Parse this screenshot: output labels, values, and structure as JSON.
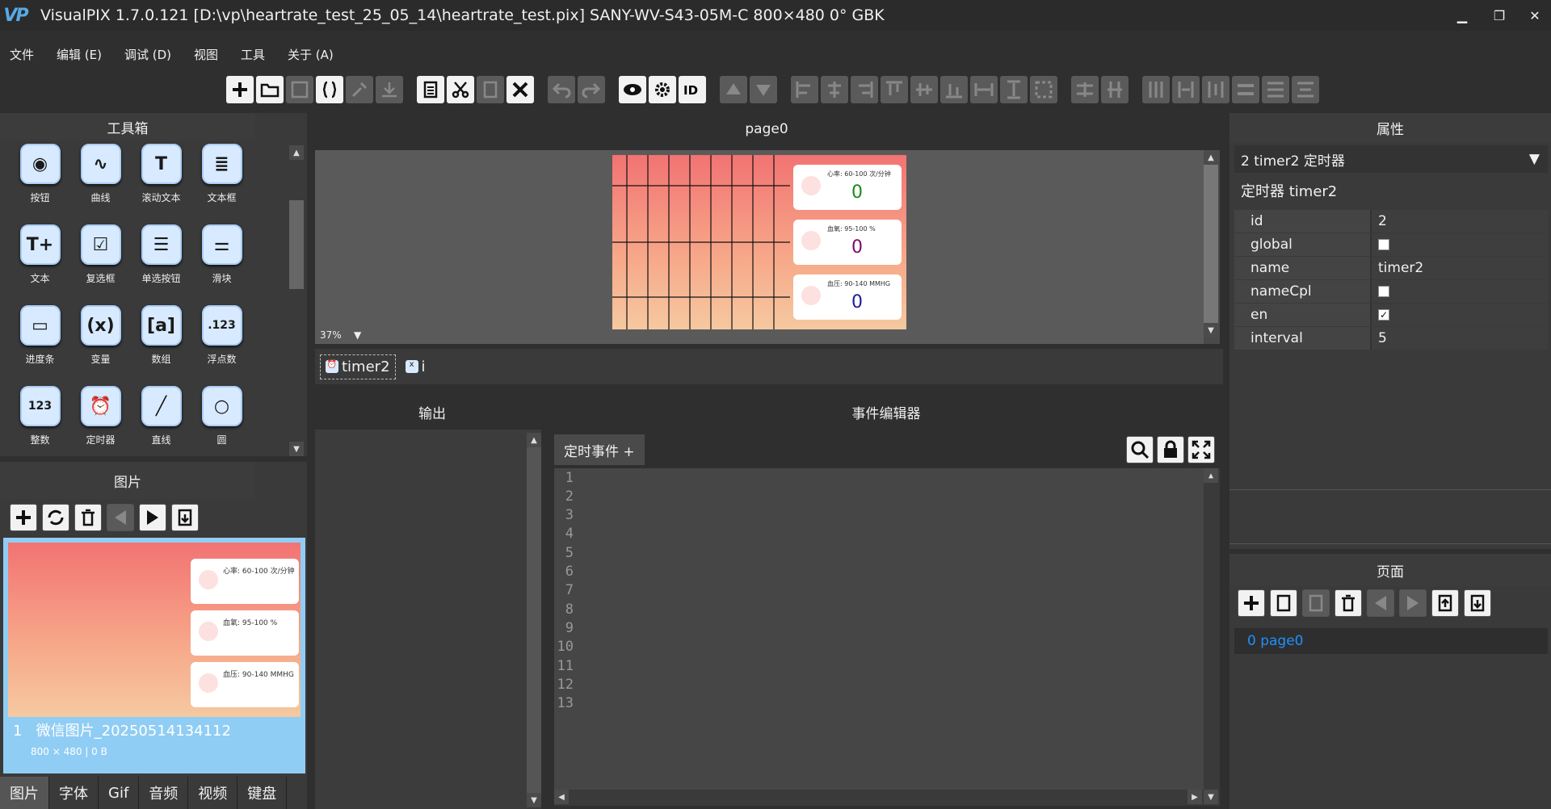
{
  "title_bar": {
    "logo": "VP",
    "text": "VisualPIX 1.7.0.121 [D:\\vp\\heartrate_test_25_05_14\\heartrate_test.pix]    SANY-WV-S43-05M-C    800×480    0°    GBK"
  },
  "menu": [
    "文件",
    "编辑 (E)",
    "调试 (D)",
    "视图",
    "工具",
    "关于 (A)"
  ],
  "toolbox": {
    "title": "工具箱",
    "items": [
      {
        "label": "按钮",
        "glyph": "◉"
      },
      {
        "label": "曲线",
        "glyph": "∿"
      },
      {
        "label": "滚动文本",
        "glyph": "T"
      },
      {
        "label": "文本框",
        "glyph": "≣"
      },
      {
        "label": "文本",
        "glyph": "T+"
      },
      {
        "label": "复选框",
        "glyph": "☑"
      },
      {
        "label": "单选按钮",
        "glyph": "☰"
      },
      {
        "label": "滑块",
        "glyph": "⚌"
      },
      {
        "label": "进度条",
        "glyph": "▭"
      },
      {
        "label": "变量",
        "glyph": "(x)"
      },
      {
        "label": "数组",
        "glyph": "[a]"
      },
      {
        "label": "浮点数",
        "glyph": ".123"
      },
      {
        "label": "整数",
        "glyph": "123"
      },
      {
        "label": "定时器",
        "glyph": "⏰"
      },
      {
        "label": "直线",
        "glyph": "╱"
      },
      {
        "label": "圆",
        "glyph": "○"
      }
    ]
  },
  "pictures": {
    "title": "图片",
    "item_index": "1",
    "item_name": "微信图片_20250514134112",
    "item_meta": "800 × 480 | 0 B",
    "thumb_cards": [
      "心率: 60-100 次/分钟",
      "血氧: 95-100 %",
      "血压: 90-140 MMHG"
    ],
    "tabs": [
      "图片",
      "字体",
      "Gif",
      "音频",
      "视频",
      "键盘"
    ]
  },
  "page": {
    "title": "page0",
    "zoom": "37%",
    "cards": [
      {
        "label": "心率: 60-100 次/分钟",
        "value": "0",
        "color": "#1a8a1a"
      },
      {
        "label": "血氧: 95-100 %",
        "value": "0",
        "color": "#7a0a6a"
      },
      {
        "label": "血压: 90-140 MMHG",
        "value": "0",
        "color": "#1a1aa0"
      }
    ]
  },
  "objects": [
    {
      "label": "timer2",
      "icon": "⏰"
    },
    {
      "label": "i",
      "icon": "x"
    }
  ],
  "output": {
    "title": "输出"
  },
  "event_editor": {
    "title": "事件编辑器",
    "tab": "定时事件 +"
  },
  "code_lines": [
    "1",
    "2",
    "3",
    "4",
    "5",
    "6",
    "7",
    "8",
    "9",
    "10",
    "11",
    "12",
    "13"
  ],
  "properties": {
    "title": "属性",
    "selector": "2  timer2  定时器",
    "header": "定时器 timer2",
    "rows": [
      {
        "k": "id",
        "v": "2"
      },
      {
        "k": "global",
        "v": ""
      },
      {
        "k": "name",
        "v": "timer2"
      },
      {
        "k": "nameCpl",
        "v": ""
      },
      {
        "k": "en",
        "v": "✓"
      },
      {
        "k": "interval",
        "v": "5"
      }
    ]
  },
  "pages": {
    "title": "页面",
    "item": "0   page0"
  }
}
